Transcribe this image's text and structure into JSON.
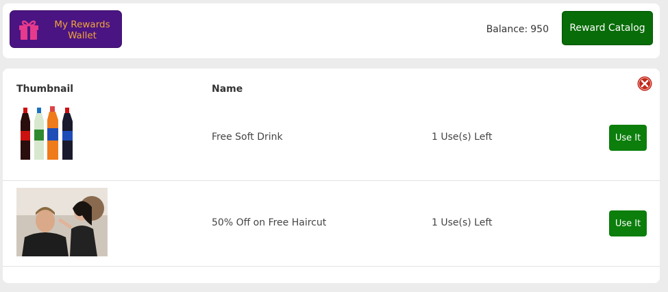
{
  "header": {
    "wallet_label": "My Rewards Wallet",
    "balance_label": "Balance:",
    "balance_value": "950",
    "catalog_button": "Reward Catalog"
  },
  "table": {
    "columns": [
      "Thumbnail",
      "Name"
    ],
    "rows": [
      {
        "name": "Free Soft Drink",
        "uses": "1 Use(s) Left",
        "action": "Use It",
        "thumbnail": "soft-drink-bottles"
      },
      {
        "name": "50% Off on Free Haircut",
        "uses": "1 Use(s) Left",
        "action": "Use It",
        "thumbnail": "haircut-photo"
      }
    ]
  },
  "colors": {
    "wallet_bg": "#4a1583",
    "wallet_text": "#f3a536",
    "catalog_bg": "#086c08",
    "use_button_bg": "#0b7e0b",
    "close_red": "#c0281b"
  }
}
